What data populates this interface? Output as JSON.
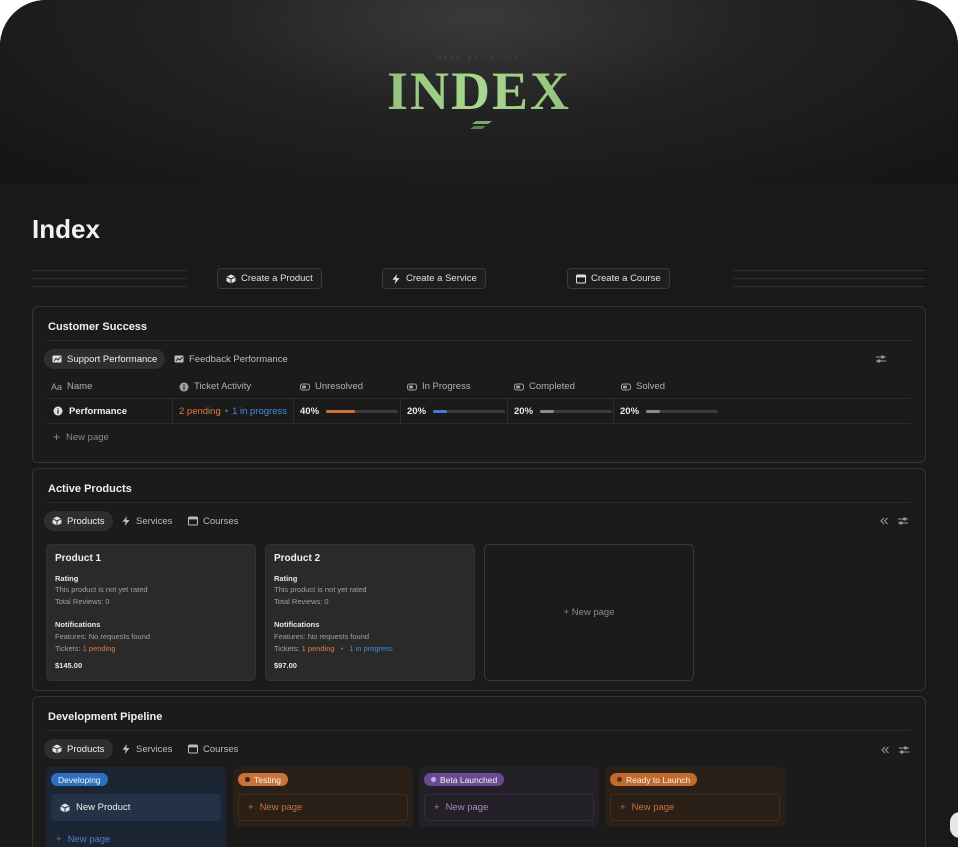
{
  "cover": {
    "logo": "INDEX",
    "tagline": "MADE BY LUCIDY"
  },
  "page": {
    "title": "Index"
  },
  "actions": [
    {
      "label": "Create a Product",
      "icon": "cube-icon"
    },
    {
      "label": "Create a Service",
      "icon": "bolt-icon"
    },
    {
      "label": "Create a Course",
      "icon": "window-icon"
    }
  ],
  "customer_success": {
    "title": "Customer Success",
    "tabs": [
      "Support Performance",
      "Feedback Performance"
    ],
    "columns": [
      "Name",
      "Ticket Activity",
      "Unresolved",
      "In Progress",
      "Completed",
      "Solved"
    ],
    "row": {
      "name": "Performance",
      "pending": "2 pending",
      "in_progress": "1 in progress",
      "unresolved": "40%",
      "in_progress_pct": "20%",
      "completed": "20%",
      "solved": "20%"
    },
    "levels": {
      "unresolved": 0.4,
      "in_progress": 0.2,
      "completed": 0.2,
      "solved": 0.2
    },
    "new_page": "New page"
  },
  "active_products": {
    "title": "Active Products",
    "tabs": [
      "Products",
      "Services",
      "Courses"
    ],
    "cards": [
      {
        "name": "Product 1",
        "rating_label": "Rating",
        "rating_text": "This product is not yet rated",
        "reviews": "Total Reviews: 0",
        "notif_label": "Notifications",
        "features": "Features: No requests found",
        "tickets_label": "Tickets:",
        "pending": "1 pending",
        "price": "$145.00"
      },
      {
        "name": "Product 2",
        "rating_label": "Rating",
        "rating_text": "This product is not yet rated",
        "reviews": "Total Reviews: 0",
        "notif_label": "Notifications",
        "features": "Features: No requests found",
        "tickets_label": "Tickets:",
        "pending": "1 pending",
        "in_progress": "1 in progress",
        "price": "$97.00"
      }
    ],
    "new_page": "New page"
  },
  "pipeline": {
    "title": "Development Pipeline",
    "tabs": [
      "Products",
      "Services",
      "Courses"
    ],
    "columns": [
      {
        "label": "Developing",
        "color": "#2f6fc0"
      },
      {
        "label": "Testing",
        "color": "#c9723a"
      },
      {
        "label": "Beta Launched",
        "color": "#7b4fa8"
      },
      {
        "label": "Ready to Launch",
        "color": "#c06a2e"
      }
    ],
    "card": "New Product",
    "new_page": "New page"
  }
}
